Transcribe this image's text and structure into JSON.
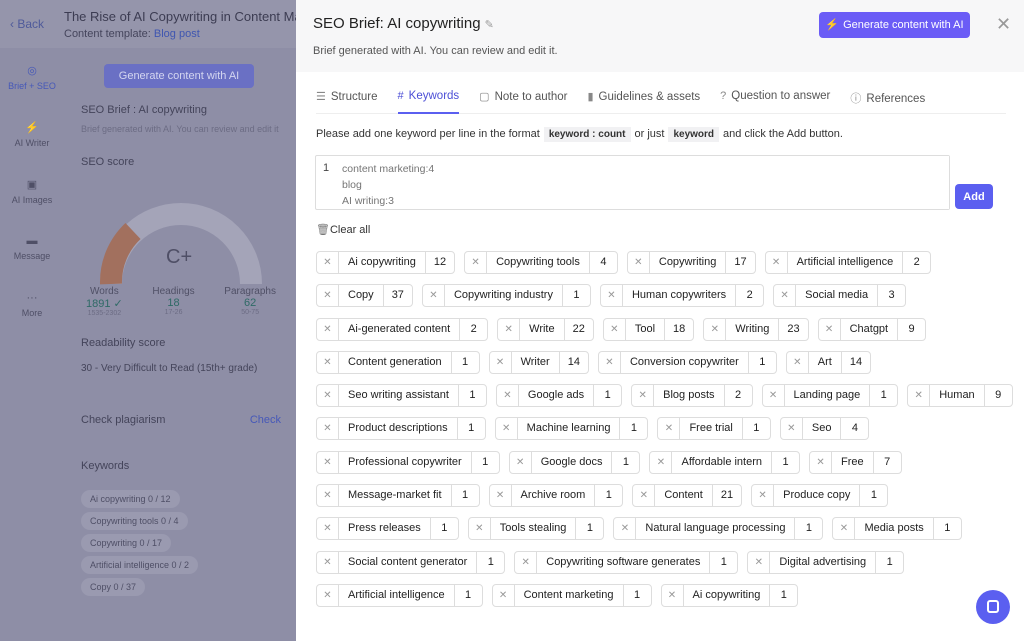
{
  "left": {
    "back": "Back",
    "doc_title": "The Rise of AI Copywriting in Content Mark",
    "template_label": "Content template:",
    "template_value": "Blog post",
    "nav": [
      {
        "label": "Brief + SEO",
        "icon": "◎"
      },
      {
        "label": "AI Writer",
        "icon": "⚡"
      },
      {
        "label": "AI Images",
        "icon": "▣"
      },
      {
        "label": "Message",
        "icon": "▬"
      },
      {
        "label": "More",
        "icon": "···"
      }
    ],
    "generate": "Generate content with AI",
    "brief_title": "SEO Brief : AI copywriting",
    "brief_sub": "Brief generated with AI. You can review and edit it",
    "seo_score": "SEO score",
    "grade": "C+",
    "stats": [
      {
        "label": "Words",
        "value": "1891 ✓",
        "range": "1535-2302"
      },
      {
        "label": "Headings",
        "value": "18",
        "range": "17-26"
      },
      {
        "label": "Paragraphs",
        "value": "62",
        "range": "50-75"
      }
    ],
    "readability_label": "Readability score",
    "readability": "30 - Very Difficult to Read (15th+ grade)",
    "plagiarism": "Check plagiarism",
    "check": "Check",
    "keywords": "Keywords",
    "kw": [
      "Ai copywriting  0 / 12",
      "Copywriting tools  0 / 4",
      "Copywriting  0 / 17",
      "Artificial intelligence  0 / 2",
      "Copy  0 / 37"
    ]
  },
  "panel": {
    "title": "SEO Brief: AI copywriting",
    "subtitle": "Brief generated with AI. You can review and edit it.",
    "generate": "Generate content with AI",
    "close": "✕",
    "tabs": [
      {
        "label": "Structure",
        "icon": "☰"
      },
      {
        "label": "Keywords",
        "icon": "#"
      },
      {
        "label": "Note to author",
        "icon": "▢"
      },
      {
        "label": "Guidelines & assets",
        "icon": "▮"
      },
      {
        "label": "Question to answer",
        "icon": "?"
      },
      {
        "label": "References",
        "icon": "ⓘ"
      }
    ],
    "instr_1": "Please add one keyword per line in the format",
    "code_1": "keyword : count",
    "instr_2": "or just",
    "code_2": "keyword",
    "instr_3": "and click the Add button.",
    "line_no": "1",
    "placeholder": "content marketing:4\nblog\nAI writing:3",
    "add": "Add",
    "clear_all": "Clear all"
  },
  "keyword_rows": [
    [
      [
        "Ai copywriting",
        "12"
      ],
      [
        "Copywriting tools",
        "4"
      ],
      [
        "Copywriting",
        "17"
      ],
      [
        "Artificial intelligence",
        "2"
      ]
    ],
    [
      [
        "Copy",
        "37"
      ],
      [
        "Copywriting industry",
        "1"
      ],
      [
        "Human copywriters",
        "2"
      ],
      [
        "Social media",
        "3"
      ]
    ],
    [
      [
        "Ai-generated content",
        "2"
      ],
      [
        "Write",
        "22"
      ],
      [
        "Tool",
        "18"
      ],
      [
        "Writing",
        "23"
      ],
      [
        "Chatgpt",
        "9"
      ]
    ],
    [
      [
        "Content generation",
        "1"
      ],
      [
        "Writer",
        "14"
      ],
      [
        "Conversion copywriter",
        "1"
      ],
      [
        "Art",
        "14"
      ]
    ],
    [
      [
        "Seo writing assistant",
        "1"
      ],
      [
        "Google ads",
        "1"
      ],
      [
        "Blog posts",
        "2"
      ],
      [
        "Landing page",
        "1"
      ],
      [
        "Human",
        "9"
      ]
    ],
    [
      [
        "Product descriptions",
        "1"
      ],
      [
        "Machine learning",
        "1"
      ],
      [
        "Free trial",
        "1"
      ],
      [
        "Seo",
        "4"
      ]
    ],
    [
      [
        "Professional copywriter",
        "1"
      ],
      [
        "Google docs",
        "1"
      ],
      [
        "Affordable intern",
        "1"
      ],
      [
        "Free",
        "7"
      ]
    ],
    [
      [
        "Message-market fit",
        "1"
      ],
      [
        "Archive room",
        "1"
      ],
      [
        "Content",
        "21"
      ],
      [
        "Produce copy",
        "1"
      ]
    ],
    [
      [
        "Press releases",
        "1"
      ],
      [
        "Tools stealing",
        "1"
      ],
      [
        "Natural language processing",
        "1"
      ],
      [
        "Media posts",
        "1"
      ]
    ],
    [
      [
        "Social content generator",
        "1"
      ],
      [
        "Copywriting software generates",
        "1"
      ],
      [
        "Digital advertising",
        "1"
      ]
    ],
    [
      [
        "Artificial intelligence",
        "1"
      ],
      [
        "Content marketing",
        "1"
      ],
      [
        "Ai copywriting",
        "1"
      ]
    ]
  ]
}
